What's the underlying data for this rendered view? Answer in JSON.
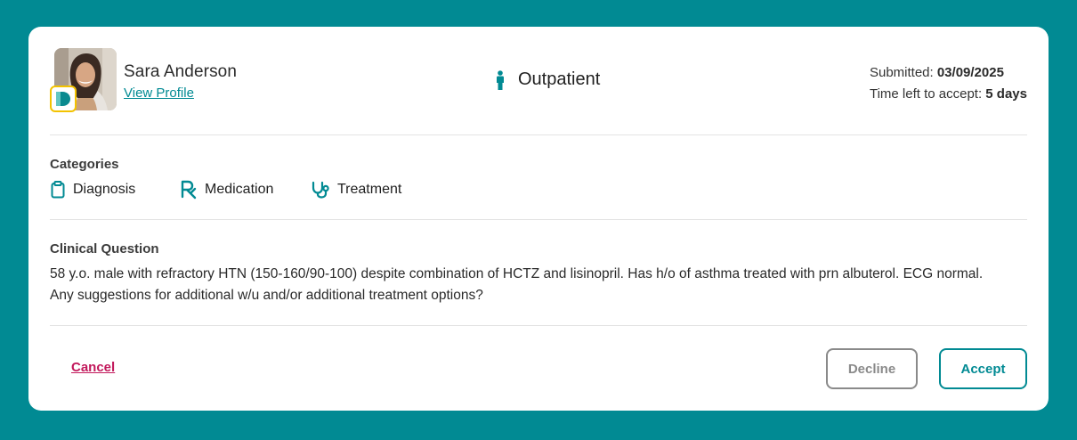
{
  "colors": {
    "background": "#018a93",
    "accent": "#018a93",
    "cancel": "#c2185b",
    "badge_border": "#f3c300"
  },
  "patient": {
    "name": "Sara Anderson",
    "view_profile_label": "View Profile",
    "avatar_icon": "patient-photo",
    "badge_icon": "brand-d-logo"
  },
  "visit": {
    "icon": "person-standing-icon",
    "type": "Outpatient"
  },
  "submission": {
    "submitted_label": "Submitted: ",
    "submitted_date": "03/09/2025",
    "time_left_label": "Time left to accept: ",
    "time_left_value": "5 days"
  },
  "categories": {
    "title": "Categories",
    "items": [
      {
        "label": "Diagnosis",
        "icon": "clipboard-icon"
      },
      {
        "label": "Medication",
        "icon": "rx-icon"
      },
      {
        "label": "Treatment",
        "icon": "stethoscope-icon"
      }
    ]
  },
  "clinical_question": {
    "title": "Clinical Question",
    "line1": "58 y.o. male with refractory HTN (150-160/90-100) despite combination of HCTZ and lisinopril. Has h/o of asthma treated with prn albuterol. ECG normal.",
    "line2": "Any suggestions for additional w/u and/or additional treatment options?"
  },
  "actions": {
    "cancel_label": "Cancel",
    "decline_label": "Decline",
    "accept_label": "Accept"
  }
}
